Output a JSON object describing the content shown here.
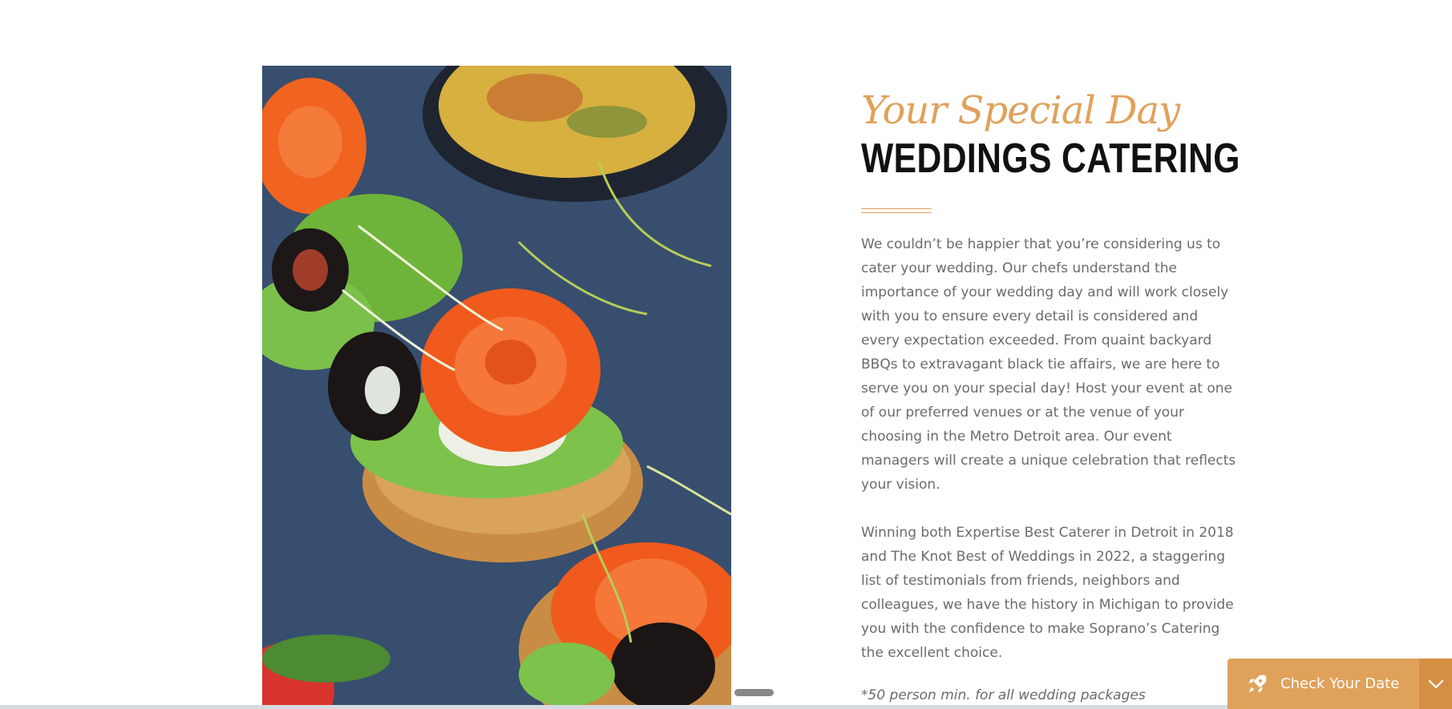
{
  "section": {
    "script_title": "Your Special Day",
    "heading": "WEDDINGS CATERING",
    "paragraph_1": "We couldn’t be happier that you’re considering us to cater your wedding. Our chefs understand the importance of your wedding day and will work closely with you to ensure every detail is considered and every expectation exceeded. From quaint backyard BBQs to extravagant black tie affairs, we are here to serve you on your special day! Host your event at one of our preferred venues or at the venue of your choosing in the Metro Detroit area. Our event managers will create a unique celebration that reflects your vision.",
    "paragraph_2": "Winning both Expertise Best Caterer in Detroit in 2018 and The Knot Best of Weddings in 2022, a staggering list of testimonials from friends, neighbors and colleagues, we have the history in Michigan to provide you with the confidence to make Soprano’s Catering the excellent choice.",
    "footnote": "*50 person min. for all wedding packages"
  },
  "image": {
    "subject": "salmon rose and olive canapés on toasted bread over dark slate"
  },
  "cta": {
    "label": "Check Your Date",
    "icon": "rocket-icon",
    "toggle_icon": "chevron-down-icon"
  },
  "colors": {
    "accent": "#e0a15a",
    "accent_dark": "#d58f42",
    "heading": "#111111",
    "body_text": "#6b6b6b"
  }
}
